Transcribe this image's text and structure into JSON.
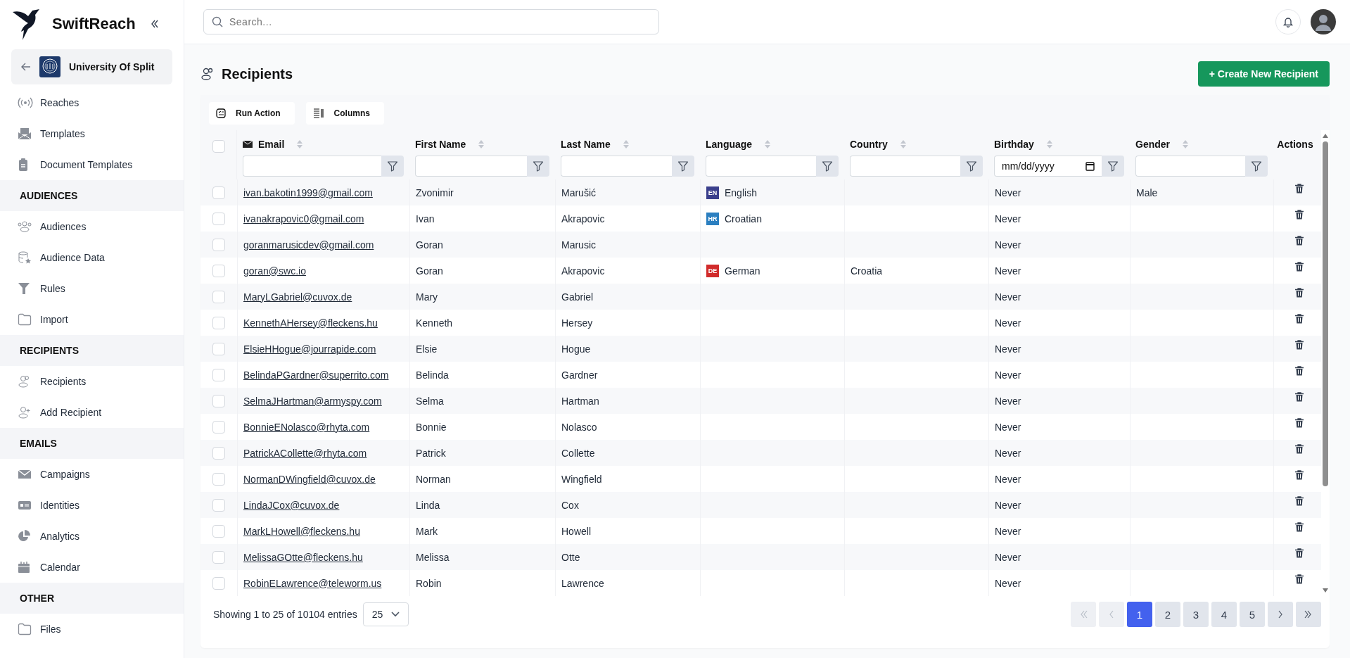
{
  "sidebar": {
    "brand": "SwiftReach",
    "organization": "University Of Split",
    "items": [
      {
        "label": "Reaches"
      },
      {
        "label": "Templates"
      },
      {
        "label": "Document Templates"
      }
    ],
    "sections": [
      {
        "heading": "AUDIENCES",
        "items": [
          {
            "label": "Audiences"
          },
          {
            "label": "Audience Data"
          },
          {
            "label": "Rules"
          },
          {
            "label": "Import"
          }
        ]
      },
      {
        "heading": "RECIPIENTS",
        "items": [
          {
            "label": "Recipients"
          },
          {
            "label": "Add Recipient"
          }
        ]
      },
      {
        "heading": "EMAILS",
        "items": [
          {
            "label": "Campaigns"
          },
          {
            "label": "Identities"
          },
          {
            "label": "Analytics"
          },
          {
            "label": "Calendar"
          }
        ]
      },
      {
        "heading": "OTHER",
        "items": [
          {
            "label": "Files"
          }
        ]
      }
    ]
  },
  "topbar": {
    "search": {
      "placeholder": "Search..."
    }
  },
  "page": {
    "title": "Recipients",
    "create_button": "+ Create New Recipient"
  },
  "toolbar": [
    {
      "label": "Run Action"
    },
    {
      "label": "Columns"
    }
  ],
  "table": {
    "select_all": {
      "checked": false
    },
    "columns": [
      {
        "label": "Email",
        "kind": "text",
        "has_icon": true
      },
      {
        "label": "First Name",
        "kind": "text"
      },
      {
        "label": "Last Name",
        "kind": "text"
      },
      {
        "label": "Language",
        "kind": "text"
      },
      {
        "label": "Country",
        "kind": "text"
      },
      {
        "label": "Birthday",
        "kind": "date",
        "placeholder": "mm/dd/yyyy"
      },
      {
        "label": "Gender",
        "kind": "text"
      },
      {
        "label": "Actions",
        "kind": "actions"
      }
    ],
    "rows": [
      {
        "checked": false,
        "email": "ivan.bakotin1999@gmail.com",
        "first_name": "Zvonimir",
        "last_name": "Marušić",
        "language": {
          "code": "EN",
          "name": "English",
          "color": "#3a3f8c"
        },
        "country": "",
        "birthday": "Never",
        "gender": "Male"
      },
      {
        "checked": false,
        "email": "ivanakrapovic0@gmail.com",
        "first_name": "Ivan",
        "last_name": "Akrapovic",
        "language": {
          "code": "HR",
          "name": "Croatian",
          "color": "#2b7fc0"
        },
        "country": "",
        "birthday": "Never",
        "gender": ""
      },
      {
        "checked": false,
        "email": "goranmarusicdev@gmail.com",
        "first_name": "Goran",
        "last_name": "Marusic",
        "country": "",
        "birthday": "Never",
        "gender": ""
      },
      {
        "checked": false,
        "email": "goran@swc.io",
        "first_name": "Goran",
        "last_name": "Akrapovic",
        "language": {
          "code": "DE",
          "name": "German",
          "color": "#d12b2b"
        },
        "country": "Croatia",
        "birthday": "Never",
        "gender": ""
      },
      {
        "checked": false,
        "email": "MaryLGabriel@cuvox.de",
        "first_name": "Mary",
        "last_name": "Gabriel",
        "country": "",
        "birthday": "Never",
        "gender": ""
      },
      {
        "checked": false,
        "email": "KennethAHersey@fleckens.hu",
        "first_name": "Kenneth",
        "last_name": "Hersey",
        "country": "",
        "birthday": "Never",
        "gender": ""
      },
      {
        "checked": false,
        "email": "ElsieHHogue@jourrapide.com",
        "first_name": "Elsie",
        "last_name": "Hogue",
        "country": "",
        "birthday": "Never",
        "gender": ""
      },
      {
        "checked": false,
        "email": "BelindaPGardner@superrito.com",
        "first_name": "Belinda",
        "last_name": "Gardner",
        "country": "",
        "birthday": "Never",
        "gender": ""
      },
      {
        "checked": false,
        "email": "SelmaJHartman@armyspy.com",
        "first_name": "Selma",
        "last_name": "Hartman",
        "country": "",
        "birthday": "Never",
        "gender": ""
      },
      {
        "checked": false,
        "email": "BonnieENolasco@rhyta.com",
        "first_name": "Bonnie",
        "last_name": "Nolasco",
        "country": "",
        "birthday": "Never",
        "gender": ""
      },
      {
        "checked": false,
        "email": "PatrickACollette@rhyta.com",
        "first_name": "Patrick",
        "last_name": "Collette",
        "country": "",
        "birthday": "Never",
        "gender": ""
      },
      {
        "checked": false,
        "email": "NormanDWingfield@cuvox.de",
        "first_name": "Norman",
        "last_name": "Wingfield",
        "country": "",
        "birthday": "Never",
        "gender": ""
      },
      {
        "checked": false,
        "email": "LindaJCox@cuvox.de",
        "first_name": "Linda",
        "last_name": "Cox",
        "country": "",
        "birthday": "Never",
        "gender": ""
      },
      {
        "checked": false,
        "email": "MarkLHowell@fleckens.hu",
        "first_name": "Mark",
        "last_name": "Howell",
        "country": "",
        "birthday": "Never",
        "gender": ""
      },
      {
        "checked": false,
        "email": "MelissaGOtte@fleckens.hu",
        "first_name": "Melissa",
        "last_name": "Otte",
        "country": "",
        "birthday": "Never",
        "gender": ""
      },
      {
        "checked": false,
        "email": "RobinELawrence@teleworm.us",
        "first_name": "Robin",
        "last_name": "Lawrence",
        "country": "",
        "birthday": "Never",
        "gender": ""
      }
    ]
  },
  "footer": {
    "summary": "Showing 1 to 25 of 10104 entries",
    "page_size": "25",
    "pagination": [
      {
        "kind": "first",
        "disabled": true
      },
      {
        "kind": "prev",
        "disabled": true
      },
      {
        "kind": "page",
        "label": "1",
        "selected": true
      },
      {
        "kind": "page",
        "label": "2",
        "selected": false
      },
      {
        "kind": "page",
        "label": "3",
        "selected": false
      },
      {
        "kind": "page",
        "label": "4",
        "selected": false
      },
      {
        "kind": "page",
        "label": "5",
        "selected": false
      },
      {
        "kind": "next",
        "disabled": false
      },
      {
        "kind": "last",
        "disabled": false
      }
    ]
  }
}
